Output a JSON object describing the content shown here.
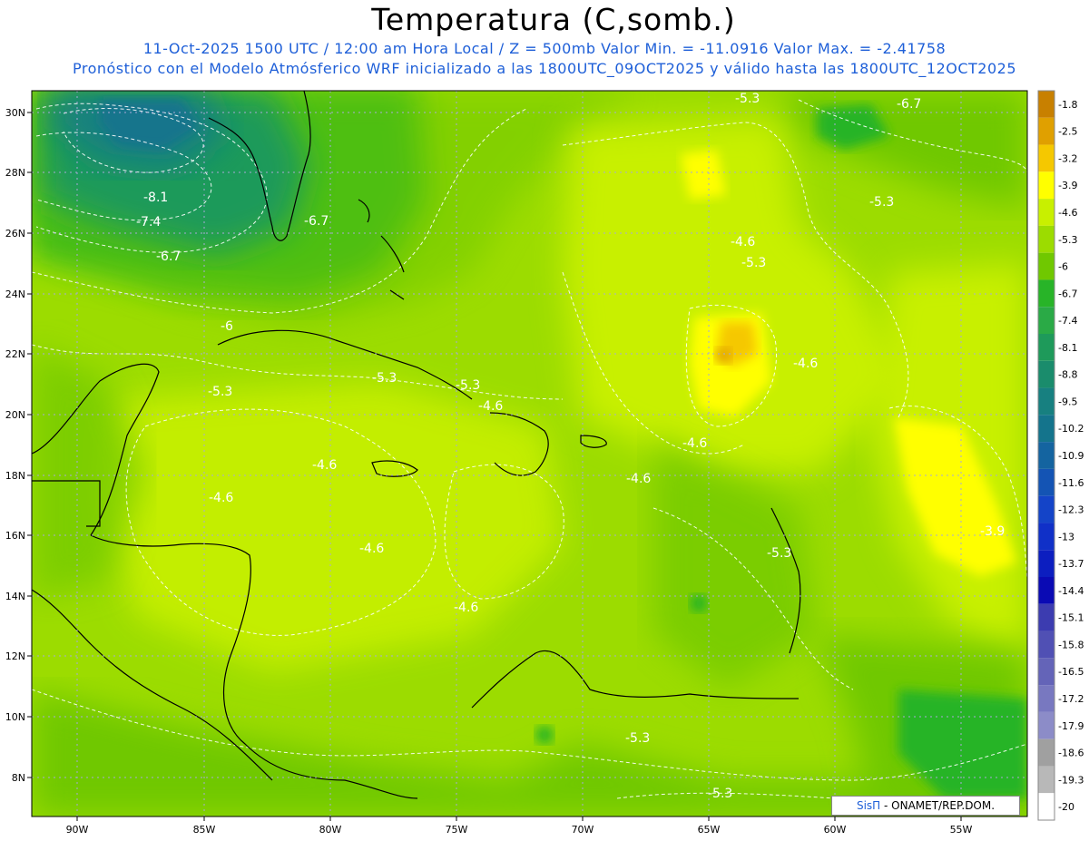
{
  "header": {
    "title": "Temperatura (C,somb.)",
    "line1": "11-Oct-2025  1500 UTC / 12:00 am Hora Local / Z = 500mb  Valor Min. = -11.0916  Valor Max. = -2.41758",
    "line2": "Pronóstico con el Modelo Atmósferico WRF inicializado a las 1800UTC_09OCT2025 y válido hasta las  1800UTC_12OCT2025"
  },
  "map": {
    "lon_ticks": [
      "90W",
      "85W",
      "80W",
      "75W",
      "70W",
      "65W",
      "60W",
      "55W"
    ],
    "lat_ticks": [
      "30N",
      "28N",
      "26N",
      "24N",
      "22N",
      "20N",
      "18N",
      "16N",
      "14N",
      "12N",
      "10N",
      "8N"
    ],
    "contour_labels": [
      "-8.1",
      "-7.4",
      "-6.7",
      "-6.7",
      "-6",
      "-5.3",
      "-5.3",
      "-5.3",
      "-4.6",
      "-4.6",
      "-4.6",
      "-4.6",
      "-4.6",
      "-4.6",
      "-4.6",
      "-4.6",
      "-5.3",
      "-5.3",
      "-5.3",
      "-6.7",
      "-5.3",
      "-4.6",
      "-3.9",
      "-5.3",
      "-5.3"
    ]
  },
  "colorbar": {
    "labels": [
      "-1.8",
      "-2.5",
      "-3.2",
      "-3.9",
      "-4.6",
      "-5.3",
      "-6",
      "-6.7",
      "-7.4",
      "-8.1",
      "-8.8",
      "-9.5",
      "-10.2",
      "-10.9",
      "-11.6",
      "-12.3",
      "-13",
      "-13.7",
      "-14.4",
      "-15.1",
      "-15.8",
      "-16.5",
      "-17.2",
      "-17.9",
      "-18.6",
      "-19.3",
      "-20"
    ],
    "colors": [
      "#c88000",
      "#e0a000",
      "#f5c800",
      "#ffff00",
      "#c8f000",
      "#9cdc00",
      "#70c800",
      "#28b428",
      "#2aaa46",
      "#1e9a5a",
      "#1a8c6c",
      "#178080",
      "#14748c",
      "#1464a0",
      "#1454b4",
      "#1444c8",
      "#1030c8",
      "#0c1ec0",
      "#0a0ab4",
      "#3c3cb0",
      "#5050b4",
      "#6464b8",
      "#7878c0",
      "#8c8cc8",
      "#a0a0a0",
      "#b8b8b8",
      "#ffffff"
    ]
  },
  "credit": {
    "brand": "SisΠ",
    "org": " - ONAMET/REP.DOM."
  }
}
